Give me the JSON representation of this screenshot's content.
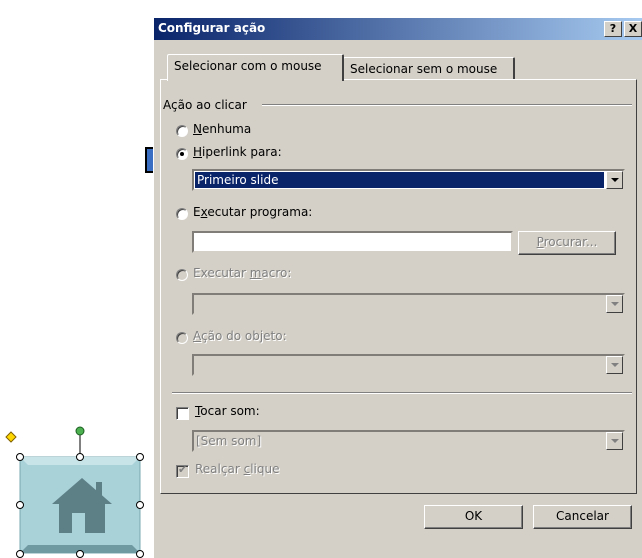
{
  "dialog": {
    "title": "Configurar ação",
    "help_button": "?",
    "close_button": "X"
  },
  "tabs": [
    {
      "label": "Selecionar com o mouse",
      "active": true
    },
    {
      "label": "Selecionar sem o mouse",
      "active": false
    }
  ],
  "group": {
    "label": "Ação ao clicar",
    "options": {
      "none": {
        "prefix": "",
        "key": "N",
        "rest": "enhuma",
        "selected": false
      },
      "hyperlink": {
        "prefix": "",
        "key": "H",
        "rest": "iperlink para:",
        "selected": true,
        "value": "Primeiro slide"
      },
      "run_program": {
        "prefix": "E",
        "key": "x",
        "rest": "ecutar programa:",
        "value": "",
        "browse_prefix": "",
        "browse_key": "P",
        "browse_rest": "rocurar..."
      },
      "run_macro": {
        "prefix": "Executar ",
        "key": "m",
        "rest": "acro:",
        "value": ""
      },
      "object_action": {
        "prefix": "",
        "key": "A",
        "rest": "ção do objeto:",
        "value": ""
      }
    }
  },
  "sound": {
    "play_prefix": "",
    "play_key": "T",
    "play_rest": "ocar som:",
    "checked": false,
    "value": "[Sem som]",
    "highlight_prefix": "Realçar ",
    "highlight_key": "c",
    "highlight_rest": "lique",
    "highlight_checked": true
  },
  "buttons": {
    "ok": "OK",
    "cancel": "Cancelar"
  },
  "colors": {
    "dialog_face": "#d4d0c8",
    "titlebar_start": "#0a246a",
    "titlebar_end": "#a6caf0",
    "selection": "#0a246a",
    "arrow": "#3a6fc4",
    "shape_fill": "#a9d1d8",
    "house": "#5d7f86"
  },
  "icons": [
    "pointer-arrow-icon",
    "home-icon",
    "adjust-handle-icon",
    "rotate-handle-icon"
  ]
}
